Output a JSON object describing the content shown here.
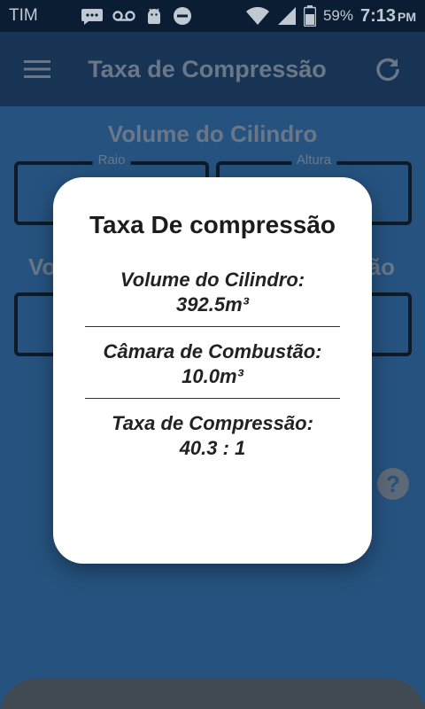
{
  "status_bar": {
    "carrier": "TIM",
    "icons": [
      "message-icon",
      "voicemail-icon",
      "android-icon",
      "do-not-disturb-icon",
      "wifi-icon",
      "signal-icon",
      "battery-icon"
    ],
    "battery_percent": "59%",
    "time": "7:13",
    "ampm": "PM"
  },
  "app_bar": {
    "title": "Taxa de Compressão",
    "menu_icon": "hamburger-menu-icon",
    "refresh_icon": "refresh-icon"
  },
  "main": {
    "cylinder_section_title": "Volume do Cilindro",
    "radius_label": "Raio",
    "height_label": "Altura",
    "chamber_section_left_fragment": "Vo",
    "chamber_section_right_fragment": "ão",
    "help_icon": "help-icon"
  },
  "dialog": {
    "title": "Taxa De compressão",
    "cylinder_volume_label": "Volume do Cilindro:",
    "cylinder_volume_value": "392.5m³",
    "combustion_chamber_label": "Câmara de Combustão:",
    "combustion_chamber_value": "10.0m³",
    "compression_ratio_label": "Taxa de Compressão:",
    "compression_ratio_value": "40.3 : 1"
  },
  "colors": {
    "status_bar": "#0b1e31",
    "app_bar": "#1a3a5c",
    "background": "#2b5f8e",
    "dialog": "#ffffff"
  }
}
